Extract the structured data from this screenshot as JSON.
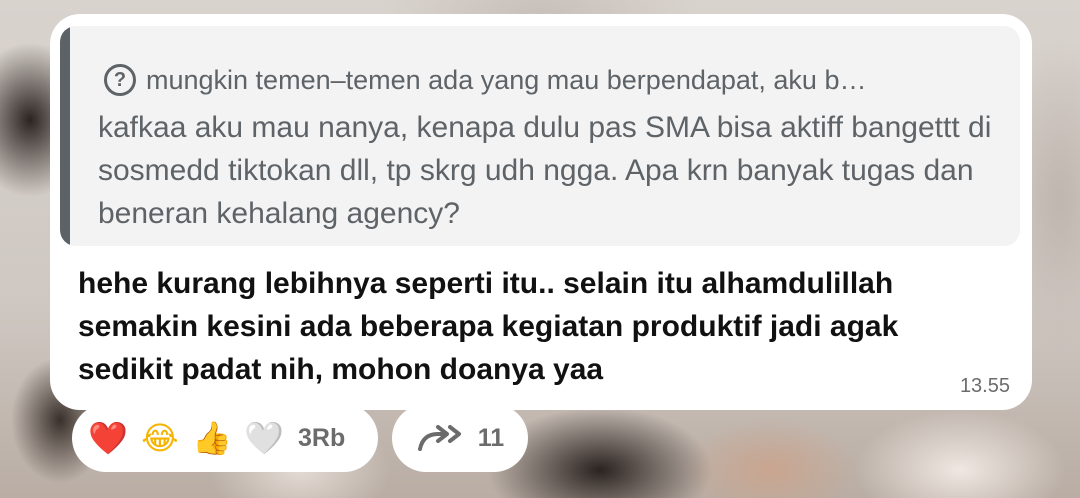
{
  "message": {
    "quote": {
      "question_icon": "question-circle-icon",
      "header": "mungkin temen–temen ada yang mau berpendapat, aku b…",
      "body": "kafkaa aku mau nanya, kenapa dulu pas SMA bisa aktiff bangettt di sosmedd tiktokan dll, tp skrg udh ngga. Apa krn banyak tugas dan beneran kehalang agency?"
    },
    "reply": "hehe kurang lebihnya seperti itu.. selain itu alhamdulillah semakin kesini ada beberapa kegiatan produktif jadi agak sedikit padat nih, mohon doanya yaa",
    "time": "13.55"
  },
  "reactions": {
    "emojis": [
      {
        "name": "red-heart-icon",
        "glyph": "❤️"
      },
      {
        "name": "tears-of-joy-icon",
        "glyph": "😂"
      },
      {
        "name": "thumbs-up-icon",
        "glyph": "👍"
      },
      {
        "name": "white-heart-icon",
        "glyph": "🤍"
      }
    ],
    "count": "3Rb"
  },
  "forward": {
    "icon": "forward-icon",
    "count": "11"
  }
}
